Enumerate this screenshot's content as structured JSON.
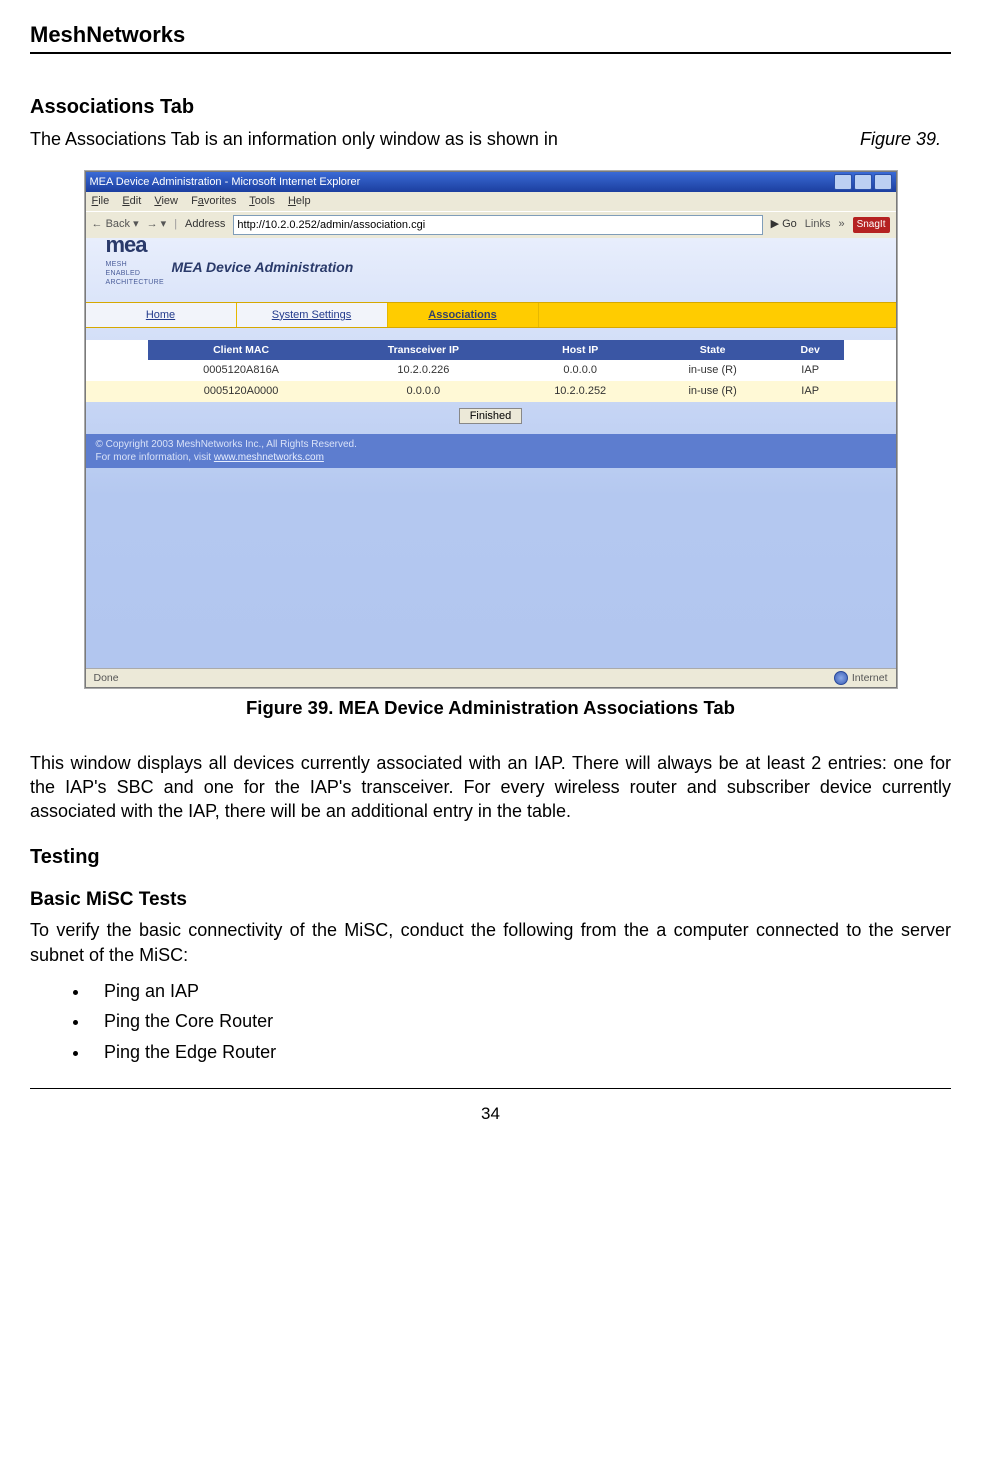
{
  "doc_header": "MeshNetworks",
  "assoc_heading": "Associations Tab",
  "intro_text": "The Associations Tab is an information only window as is shown in",
  "intro_ref": "Figure 39.",
  "caption": "Figure 39.      MEA Device Administration Associations Tab",
  "para_after_fig": "This window displays all devices currently associated with an IAP.  There will always be at least 2 entries: one for the IAP's SBC and one for the IAP's transceiver.  For every wireless router and subscriber device currently associated with the IAP, there will be an additional entry in the table.",
  "testing_heading": "Testing",
  "basic_heading": "Basic MiSC Tests",
  "basic_para": "To verify the basic connectivity of the MiSC, conduct the following from the a computer connected to the server subnet of the MiSC:",
  "bullets": {
    "b1": "Ping an IAP",
    "b2": "Ping the Core Router",
    "b3": "Ping the Edge Router"
  },
  "page_number": "34",
  "ie": {
    "title": "MEA Device Administration - Microsoft Internet Explorer",
    "menu": {
      "file": "File",
      "edit": "Edit",
      "view": "View",
      "fav": "Favorites",
      "tools": "Tools",
      "help": "Help"
    },
    "toolbar": {
      "back": "Back",
      "address_label": "Address",
      "url": "http://10.2.0.252/admin/association.cgi",
      "go": "Go",
      "links": "Links",
      "snagit": "SnagIt"
    },
    "logo": {
      "word": "mea",
      "sub": "MESH ENABLED\nARCHITECTURE"
    },
    "pagetitle": "MEA Device Administration",
    "tabs": {
      "home": "Home",
      "system": "System Settings",
      "assoc": "Associations"
    },
    "columns": {
      "mac": "Client MAC",
      "txip": "Transceiver IP",
      "hostip": "Host IP",
      "state": "State",
      "dev": "Dev"
    },
    "rows": [
      {
        "mac": "0005120A816A",
        "txip": "10.2.0.226",
        "hostip": "0.0.0.0",
        "state": "in-use (R)",
        "dev": "IAP"
      },
      {
        "mac": "0005120A0000",
        "txip": "0.0.0.0",
        "hostip": "10.2.0.252",
        "state": "in-use (R)",
        "dev": "IAP"
      }
    ],
    "finished": "Finished",
    "copyright_line1": "© Copyright 2003 MeshNetworks Inc., All Rights Reserved.",
    "copyright_line2_pre": "For more information, visit ",
    "copyright_link": "www.meshnetworks.com",
    "status_done": "Done",
    "status_zone": "Internet"
  }
}
